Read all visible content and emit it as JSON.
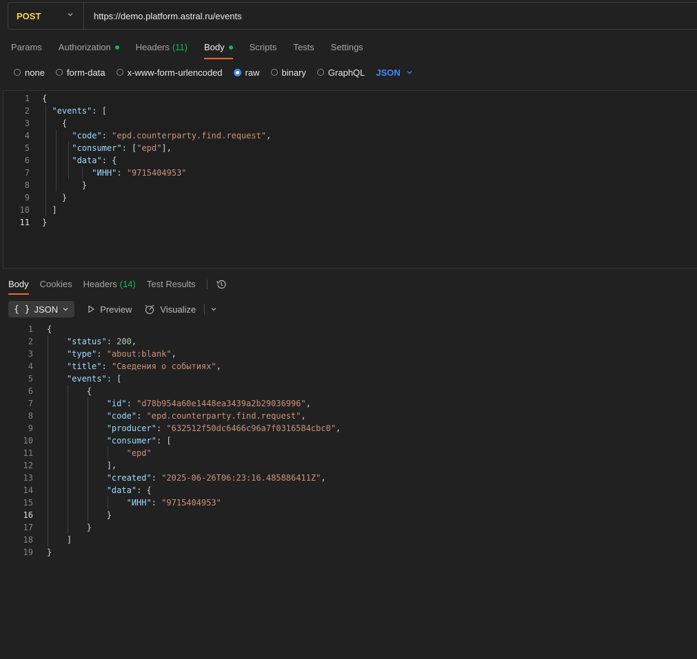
{
  "request": {
    "method": "POST",
    "url": "https://demo.platform.astral.ru/events"
  },
  "request_tabs": [
    {
      "label": "Params",
      "active": false,
      "dot": false,
      "count": ""
    },
    {
      "label": "Authorization",
      "active": false,
      "dot": true,
      "count": ""
    },
    {
      "label": "Headers",
      "active": false,
      "dot": false,
      "count": "(11)"
    },
    {
      "label": "Body",
      "active": true,
      "dot": true,
      "count": ""
    },
    {
      "label": "Scripts",
      "active": false,
      "dot": false,
      "count": ""
    },
    {
      "label": "Tests",
      "active": false,
      "dot": false,
      "count": ""
    },
    {
      "label": "Settings",
      "active": false,
      "dot": false,
      "count": ""
    }
  ],
  "body_types": [
    {
      "label": "none",
      "selected": false
    },
    {
      "label": "form-data",
      "selected": false
    },
    {
      "label": "x-www-form-urlencoded",
      "selected": false
    },
    {
      "label": "raw",
      "selected": true
    },
    {
      "label": "binary",
      "selected": false
    },
    {
      "label": "GraphQL",
      "selected": false
    }
  ],
  "body_format": "JSON",
  "request_body_lines": [
    [
      [
        "p",
        "{"
      ]
    ],
    [
      [
        "p",
        "  "
      ],
      [
        "k",
        "\"events\""
      ],
      [
        "p",
        ": ["
      ]
    ],
    [
      [
        "p",
        "    {"
      ]
    ],
    [
      [
        "p",
        "      "
      ],
      [
        "k",
        "\"code\""
      ],
      [
        "p",
        ": "
      ],
      [
        "s",
        "\"epd.counterparty.find.request\""
      ],
      [
        "p",
        ","
      ]
    ],
    [
      [
        "p",
        "      "
      ],
      [
        "k",
        "\"consumer\""
      ],
      [
        "p",
        ": ["
      ],
      [
        "s",
        "\"epd\""
      ],
      [
        "p",
        "],"
      ]
    ],
    [
      [
        "p",
        "      "
      ],
      [
        "k",
        "\"data\""
      ],
      [
        "p",
        ": {"
      ]
    ],
    [
      [
        "p",
        "          "
      ],
      [
        "k",
        "\"ИНН\""
      ],
      [
        "p",
        ": "
      ],
      [
        "s",
        "\"9715404953\""
      ]
    ],
    [
      [
        "p",
        "        }"
      ]
    ],
    [
      [
        "p",
        "    }"
      ]
    ],
    [
      [
        "p",
        "  ]"
      ]
    ],
    [
      [
        "p",
        "}"
      ]
    ]
  ],
  "request_current_line": 11,
  "response_tabs": [
    {
      "label": "Body",
      "active": true,
      "count": ""
    },
    {
      "label": "Cookies",
      "active": false,
      "count": ""
    },
    {
      "label": "Headers",
      "active": false,
      "count": "(14)"
    },
    {
      "label": "Test Results",
      "active": false,
      "count": ""
    }
  ],
  "response_tools": {
    "format_label": "JSON",
    "format_brace": "{ }",
    "preview_label": "Preview",
    "visualize_label": "Visualize"
  },
  "response_body_lines": [
    [
      [
        "p",
        "{"
      ]
    ],
    [
      [
        "p",
        "    "
      ],
      [
        "k",
        "\"status\""
      ],
      [
        "p",
        ": "
      ],
      [
        "n",
        "200"
      ],
      [
        "p",
        ","
      ]
    ],
    [
      [
        "p",
        "    "
      ],
      [
        "k",
        "\"type\""
      ],
      [
        "p",
        ": "
      ],
      [
        "s",
        "\"about:blank\""
      ],
      [
        "p",
        ","
      ]
    ],
    [
      [
        "p",
        "    "
      ],
      [
        "k",
        "\"title\""
      ],
      [
        "p",
        ": "
      ],
      [
        "s",
        "\"Сведения о событиях\""
      ],
      [
        "p",
        ","
      ]
    ],
    [
      [
        "p",
        "    "
      ],
      [
        "k",
        "\"events\""
      ],
      [
        "p",
        ": ["
      ]
    ],
    [
      [
        "p",
        "        {"
      ]
    ],
    [
      [
        "p",
        "            "
      ],
      [
        "k",
        "\"id\""
      ],
      [
        "p",
        ": "
      ],
      [
        "s",
        "\"d78b954a60e1448ea3439a2b29036996\""
      ],
      [
        "p",
        ","
      ]
    ],
    [
      [
        "p",
        "            "
      ],
      [
        "k",
        "\"code\""
      ],
      [
        "p",
        ": "
      ],
      [
        "s",
        "\"epd.counterparty.find.request\""
      ],
      [
        "p",
        ","
      ]
    ],
    [
      [
        "p",
        "            "
      ],
      [
        "k",
        "\"producer\""
      ],
      [
        "p",
        ": "
      ],
      [
        "s",
        "\"632512f50dc6466c96a7f0316584cbc0\""
      ],
      [
        "p",
        ","
      ]
    ],
    [
      [
        "p",
        "            "
      ],
      [
        "k",
        "\"consumer\""
      ],
      [
        "p",
        ": ["
      ]
    ],
    [
      [
        "p",
        "                "
      ],
      [
        "s",
        "\"epd\""
      ]
    ],
    [
      [
        "p",
        "            ],"
      ]
    ],
    [
      [
        "p",
        "            "
      ],
      [
        "k",
        "\"created\""
      ],
      [
        "p",
        ": "
      ],
      [
        "s",
        "\"2025-06-26T06:23:16.485886411Z\""
      ],
      [
        "p",
        ","
      ]
    ],
    [
      [
        "p",
        "            "
      ],
      [
        "k",
        "\"data\""
      ],
      [
        "p",
        ": {"
      ]
    ],
    [
      [
        "p",
        "                "
      ],
      [
        "k",
        "\"ИНН\""
      ],
      [
        "p",
        ": "
      ],
      [
        "s",
        "\"9715404953\""
      ]
    ],
    [
      [
        "p",
        "            }"
      ]
    ],
    [
      [
        "p",
        "        }"
      ]
    ],
    [
      [
        "p",
        "    ]"
      ]
    ],
    [
      [
        "p",
        "}"
      ]
    ]
  ],
  "response_current_line": 16,
  "colors": {
    "accent_tab": "#f06533",
    "method": "#ffd24d",
    "indicator": "#0cbb52",
    "link": "#3d8bfd"
  }
}
